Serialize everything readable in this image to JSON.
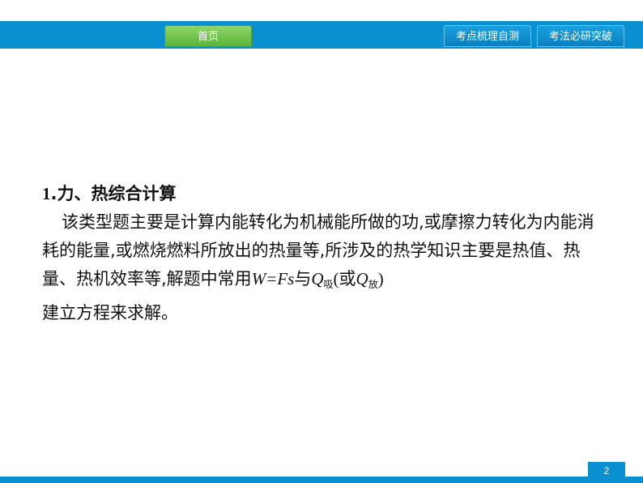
{
  "nav": {
    "home": "首页",
    "tab1": "考点梳理自测",
    "tab2": "考法必研突破"
  },
  "content": {
    "heading_num": "1",
    "heading_text": ".力、热综合计算",
    "paragraph_text": "该类型题主要是计算内能转化为机械能所做的功,或摩擦力转化为内能消耗的能量,或燃烧燃料所放出的热量等,所涉及的热学知识主要是热值、热量、热机效率等,解题中常用",
    "formula_w": "W=Fs",
    "connector": "与",
    "q": "Q",
    "q_sub_absorb": "吸",
    "paren_open": "(",
    "or": "或",
    "q_sub_release": "放",
    "paren_close": ")",
    "ending": "建立方程来求解。"
  },
  "footer": {
    "page_number": "2"
  },
  "colors": {
    "bar_blue": "#0a8fd0",
    "home_green": "#5bb53a"
  }
}
